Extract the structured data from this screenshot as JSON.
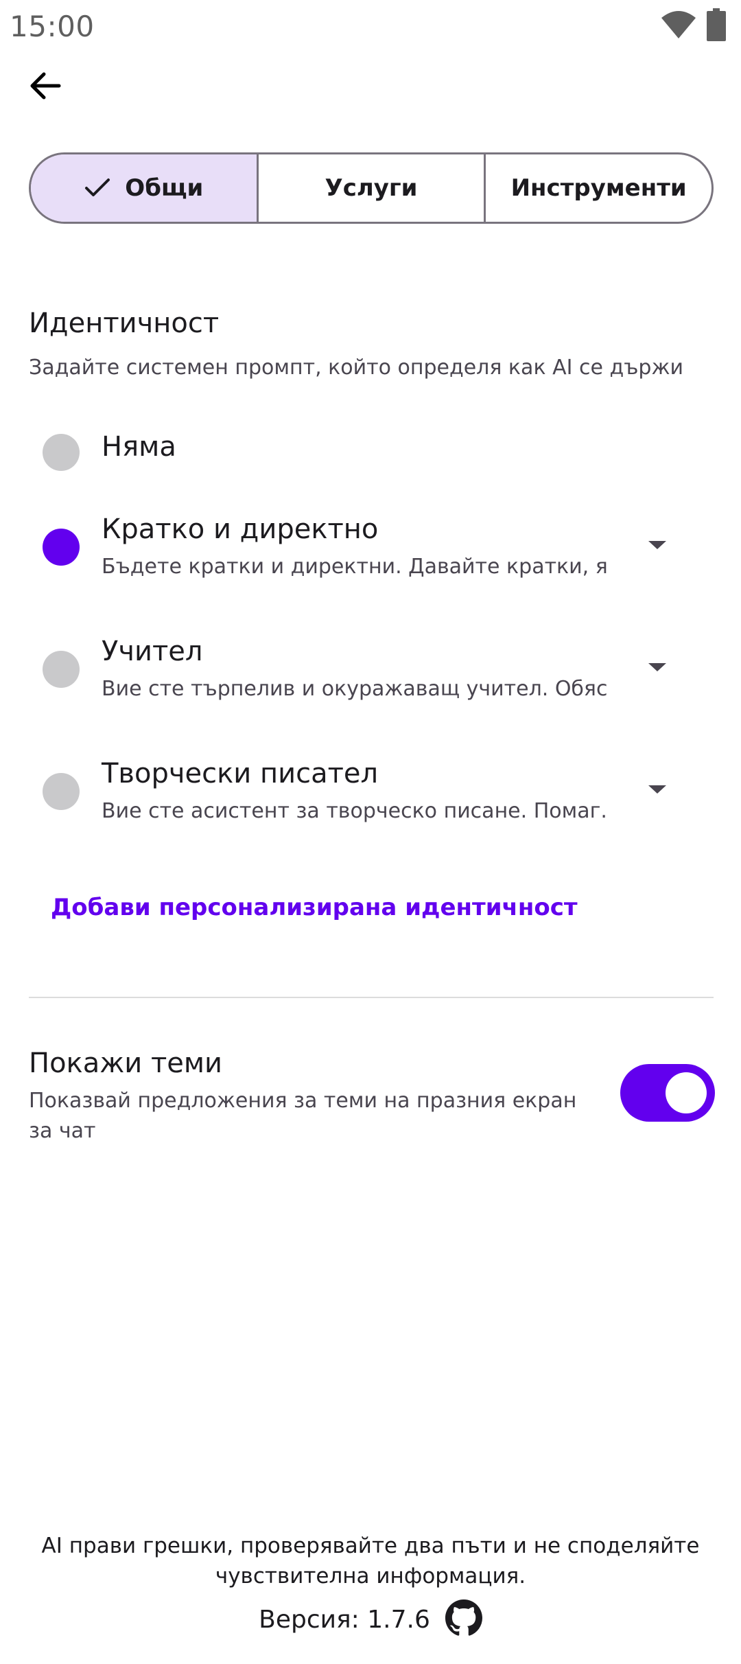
{
  "status_bar": {
    "time": "15:00",
    "icons": [
      "wifi-icon",
      "battery-icon"
    ]
  },
  "header": {
    "back_icon": "arrow-back-icon"
  },
  "tabs": [
    {
      "label": "Общи",
      "selected": true
    },
    {
      "label": "Услуги",
      "selected": false
    },
    {
      "label": "Инструменти",
      "selected": false
    }
  ],
  "identity": {
    "title": "Идентичност",
    "subtitle": "Задайте системен промпт, който определя как AI се държи",
    "options": [
      {
        "title": "Няма",
        "description": "",
        "selected": false,
        "expandable": false
      },
      {
        "title": "Кратко и директно",
        "description": "Бъдете кратки и директни. Давайте кратки, я...",
        "selected": true,
        "expandable": true
      },
      {
        "title": "Учител",
        "description": "Вие сте търпелив и окуражаващ учител. Обяс...",
        "selected": false,
        "expandable": true
      },
      {
        "title": "Творчески писател",
        "description": "Вие сте асистент за творческо писане. Помаг...",
        "selected": false,
        "expandable": true
      }
    ],
    "add_custom_label": "Добави персонализирана идентичност"
  },
  "topics": {
    "title": "Покажи теми",
    "description": "Показвай предложения за теми на празния екран за чат",
    "enabled": true
  },
  "footer": {
    "disclaimer": "AI прави грешки, проверявайте два пъти и не споделяйте чувствителна информация.",
    "version": "Версия: 1.7.6",
    "github_icon": "github-icon"
  },
  "colors": {
    "accent": "#6200ee",
    "selected_tab_bg": "#e8def8",
    "radio_unselected": "#c9c9cb"
  }
}
